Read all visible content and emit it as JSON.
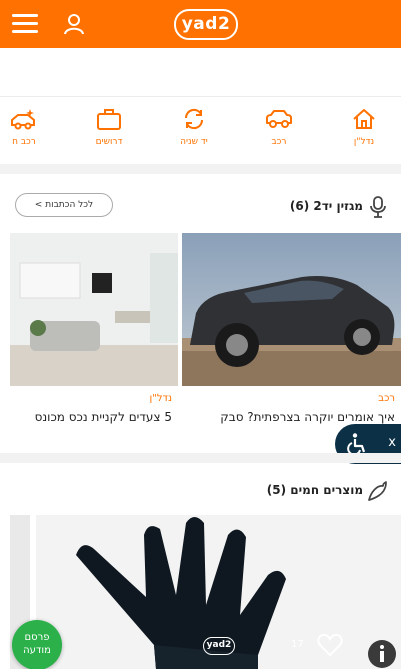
{
  "header": {
    "logo_text": "yad2",
    "brand_color": "#ff7100"
  },
  "categories": [
    {
      "label": "נדל\"ן",
      "icon": "home-icon"
    },
    {
      "label": "רכב",
      "icon": "car-icon"
    },
    {
      "label": "יד שניה",
      "icon": "refresh-icon"
    },
    {
      "label": "דרושים",
      "icon": "briefcase-icon"
    },
    {
      "label": "רכב ח",
      "icon": "sparkle-car-icon"
    }
  ],
  "magazine": {
    "title": "מגזין יד2 (6)",
    "icon": "microphone-icon",
    "all_label": "לכל הכתבות >",
    "cards": [
      {
        "tag": "רכב",
        "title": "איך אומרים יוקרה בצרפתית? סבק במבחן"
      },
      {
        "tag": "נדל\"ן",
        "title": "5 צעדים לקניית נכס מכונס"
      }
    ]
  },
  "accessibility": {
    "close_label": "x",
    "icon": "wheelchair-icon",
    "color": "#0c3046"
  },
  "hot_products": {
    "title": "מוצרים חמים (5)",
    "icon": "chili-icon",
    "card": {
      "logo_text": "yad2",
      "likes": "17"
    }
  },
  "fab": {
    "line1": "פרסם",
    "line2": "מודעה",
    "color": "#2bb04a"
  }
}
